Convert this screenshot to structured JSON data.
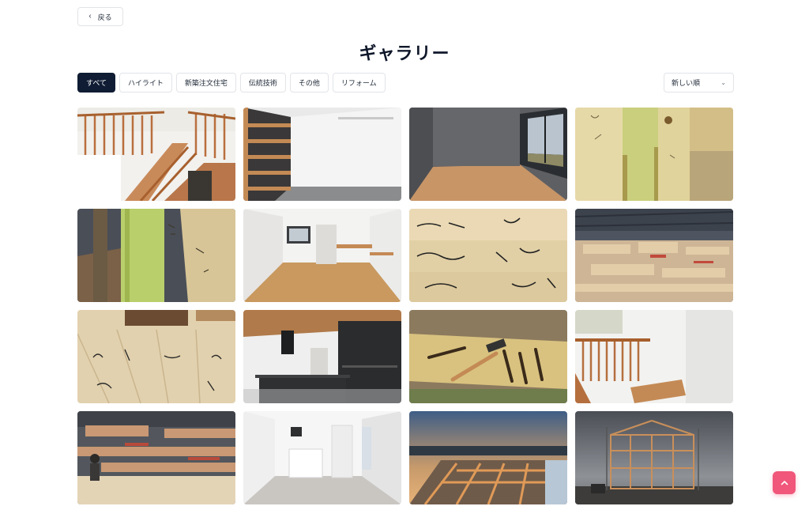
{
  "nav": {
    "back_label": "戻る"
  },
  "page": {
    "title": "ギャラリー"
  },
  "filters": [
    {
      "label": "すべて",
      "active": true
    },
    {
      "label": "ハイライト",
      "active": false
    },
    {
      "label": "新築注文住宅",
      "active": false
    },
    {
      "label": "伝統技術",
      "active": false
    },
    {
      "label": "その他",
      "active": false
    },
    {
      "label": "リフォーム",
      "active": false
    }
  ],
  "sort": {
    "selected": "新しい順"
  },
  "gallery": {
    "photos": [
      "staircase-wood-railing",
      "walk-in-closet-shelves",
      "empty-room-balcony-door",
      "timber-post-markings",
      "timber-post-closeup",
      "bright-room-wood-floor",
      "beam-writing-closeup",
      "timber-workshop-stacks",
      "marked-floor-boards",
      "kitchen-wood-ceiling",
      "carpenter-chisels-hammer",
      "loft-railing-steps",
      "workshop-carpenter",
      "white-room-kitchenette",
      "floor-framing-sunset",
      "house-frame-raising"
    ]
  },
  "icons": {
    "back": "chevron-left-icon",
    "sort": "chevron-down-icon",
    "scroll_top": "chevron-up-icon"
  },
  "colors": {
    "accent": "#0f1c33",
    "scroll_top": "#f0577a"
  }
}
